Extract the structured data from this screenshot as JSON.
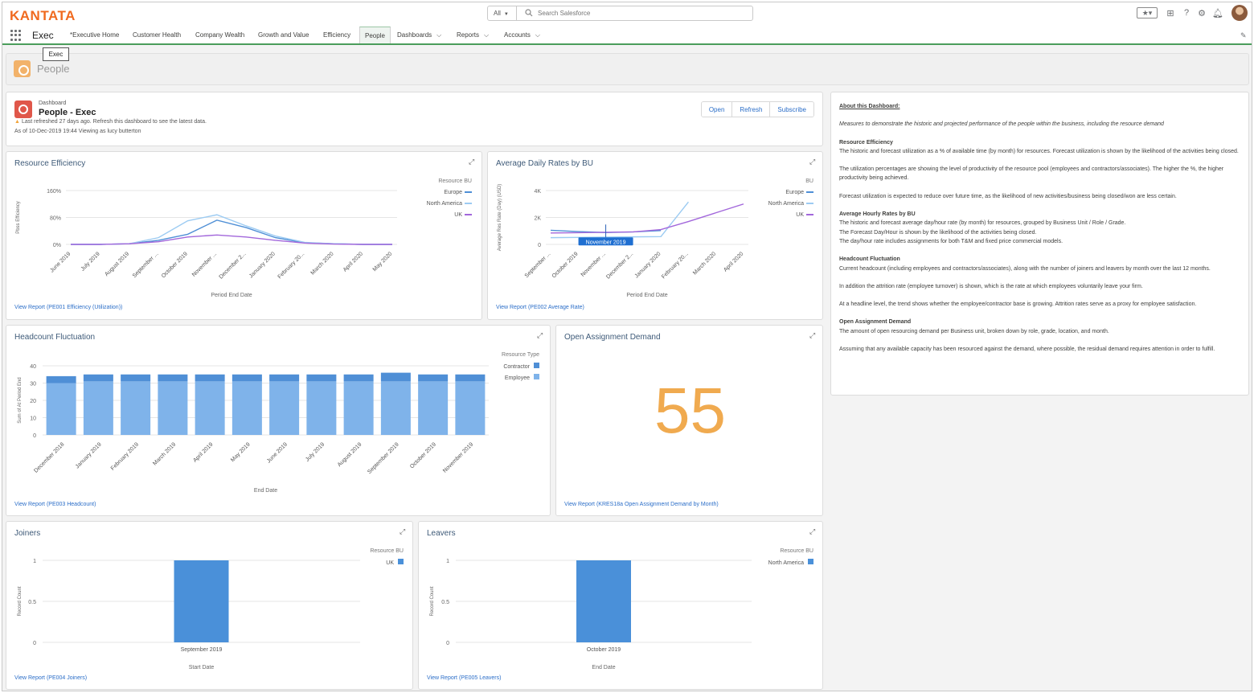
{
  "header": {
    "logo": "KANTATA",
    "search_scope": "All",
    "search_placeholder": "Search Salesforce"
  },
  "nav": {
    "app_name": "Exec",
    "items": [
      {
        "label": "*Executive Home"
      },
      {
        "label": "Customer Health"
      },
      {
        "label": "Company Wealth"
      },
      {
        "label": "Growth and Value"
      },
      {
        "label": "Efficiency"
      },
      {
        "label": "People"
      },
      {
        "label": "Dashboards"
      },
      {
        "label": "Reports"
      },
      {
        "label": "Accounts"
      }
    ],
    "tooltip": "Exec"
  },
  "page": {
    "title": "People"
  },
  "dashboard": {
    "eyebrow": "Dashboard",
    "title": "People - Exec",
    "warning": "Last refreshed 27 days ago. Refresh this dashboard to see the latest data.",
    "as_of": "As of 10-Dec-2019 19:44 Viewing as lucy butterton",
    "buttons": {
      "open": "Open",
      "refresh": "Refresh",
      "subscribe": "Subscribe"
    }
  },
  "cards": {
    "efficiency": {
      "title": "Resource Efficiency",
      "link": "View Report (PE001 Efficiency (Utilization))"
    },
    "rates": {
      "title": "Average Daily Rates by BU",
      "link": "View Report (PE002 Average Rate)"
    },
    "headcount": {
      "title": "Headcount Fluctuation",
      "link": "View Report (PE003 Headcount)"
    },
    "demand": {
      "title": "Open Assignment Demand",
      "value": "55",
      "link": "View Report (KRES18a Open Assignment Demand by Month)"
    },
    "joiners": {
      "title": "Joiners",
      "link": "View Report (PE004 Joiners)"
    },
    "leavers": {
      "title": "Leavers",
      "link": "View Report (PE005 Leavers)"
    }
  },
  "about": {
    "heading": "About this Dashboard:",
    "intro": "Measures to demonstrate the historic and projected performance of the people within the business, including the resource demand",
    "s1_h": "Resource Efficiency",
    "s1_p1": "The historic and forecast utilization as a % of available time (by month) for resources. Forecast utilization is shown by the likelihood of the activities being closed.",
    "s1_p2": "The utilization percentages are showing the level of productivity of the resource pool (employees and contractors/associates). The higher the %, the higher productivity being achieved.",
    "s1_p3": "Forecast utilization is expected to reduce over future time, as the likelihood of new activities/business being closed/won are less certain.",
    "s2_h": "Average Hourly Rates by BU",
    "s2_l1": "The historic and forecast average day/hour rate (by month) for resources, grouped by Business Unit / Role / Grade.",
    "s2_l2": "The Forecast Day/Hour is shown by the likelihood of the activities being closed.",
    "s2_l3": "The day/hour rate includes assignments for both T&M and fixed price commercial models.",
    "s3_h": "Headcount Fluctuation",
    "s3_p1": "Current headcount (including employees and contractors/associates), along with the number of joiners and leavers by month over the last 12 months.",
    "s3_p2": "In addition the attrition rate (employee turnover) is shown, which is the rate at which employees voluntarily leave your firm.",
    "s3_p3": "At a headline level, the trend shows whether the employee/contractor base is growing. Attrition rates serve as a proxy for employee satisfaction.",
    "s4_h": "Open Assignment Demand",
    "s4_p1": "The amount of open resourcing demand per Business unit, broken down by role, grade, location, and month.",
    "s4_p2": "Assuming that any available capacity has been resourced against the demand, where possible, the residual demand requires attention in order to fulfill."
  },
  "chart_data": [
    {
      "id": "efficiency",
      "type": "line",
      "ylabel": "Pbss Efficiency",
      "xlabel": "Period End Date",
      "legend_title": "Resource BU",
      "yticks": [
        "160%",
        "80%",
        "0%"
      ],
      "ylim": [
        0,
        160
      ],
      "categories": [
        "June 2019",
        "July 2019",
        "August 2019",
        "September ...",
        "October 2019",
        "November ...",
        "December 2...",
        "January 2020",
        "February 20...",
        "March 2020",
        "April 2020",
        "May 2020"
      ],
      "series": [
        {
          "name": "Europe",
          "color": "#4f8fd6",
          "values": [
            0,
            0,
            2,
            12,
            30,
            72,
            50,
            20,
            5,
            2,
            0,
            0
          ]
        },
        {
          "name": "North America",
          "color": "#9ccbf2",
          "values": [
            0,
            0,
            2,
            20,
            70,
            88,
            55,
            25,
            6,
            2,
            0,
            0
          ]
        },
        {
          "name": "UK",
          "color": "#a267db",
          "values": [
            0,
            0,
            2,
            8,
            22,
            28,
            22,
            12,
            4,
            1,
            0,
            0
          ]
        }
      ]
    },
    {
      "id": "rates",
      "type": "line",
      "ylabel": "Average Res Rate (Day) (USD)",
      "xlabel": "Period End Date",
      "legend_title": "BU",
      "yticks": [
        "4K",
        "2K",
        "0"
      ],
      "ylim": [
        0,
        4000
      ],
      "tooltip": "November 2019",
      "categories": [
        "September ...",
        "October 2019",
        "November ...",
        "December 2...",
        "January 2020",
        "February 20...",
        "March 2020",
        "April 2020"
      ],
      "series": [
        {
          "name": "Europe",
          "color": "#4f8fd6",
          "values": [
            1050,
            950,
            880,
            930,
            1030,
            null,
            null,
            null
          ]
        },
        {
          "name": "North America",
          "color": "#9ccbf2",
          "values": [
            500,
            520,
            540,
            560,
            580,
            3150,
            null,
            null
          ]
        },
        {
          "name": "UK",
          "color": "#a267db",
          "values": [
            850,
            870,
            900,
            930,
            1100,
            1700,
            2350,
            3000
          ]
        }
      ]
    },
    {
      "id": "headcount",
      "type": "bar",
      "stacked": true,
      "ylabel": "Sum of At Period End",
      "xlabel": "End Date",
      "legend_title": "Resource Type",
      "ylim": [
        0,
        40
      ],
      "yticks": [
        40,
        30,
        20,
        10,
        0
      ],
      "categories": [
        "December 2018",
        "January 2019",
        "February 2019",
        "March 2019",
        "April 2019",
        "May 2019",
        "June 2019",
        "July 2019",
        "August 2019",
        "September 2019",
        "October 2019",
        "November 2019"
      ],
      "series": [
        {
          "name": "Employee",
          "color": "#7fb3ea",
          "values": [
            30,
            31,
            31,
            31,
            31,
            31,
            31,
            31,
            31,
            31,
            31,
            31
          ]
        },
        {
          "name": "Contractor",
          "color": "#4f8fd6",
          "values": [
            4,
            4,
            4,
            4,
            4,
            4,
            4,
            4,
            4,
            5,
            4,
            4
          ]
        }
      ]
    },
    {
      "id": "joiners",
      "type": "bar",
      "ylabel": "Record Count",
      "xlabel": "Start Date",
      "legend_title": "Resource BU",
      "ylim": [
        0,
        1
      ],
      "yticks": [
        "1",
        "0.5",
        "0"
      ],
      "categories": [
        "September 2019"
      ],
      "series": [
        {
          "name": "UK",
          "color": "#4a90d9",
          "values": [
            1
          ]
        }
      ]
    },
    {
      "id": "leavers",
      "type": "bar",
      "ylabel": "Record Count",
      "xlabel": "End Date",
      "legend_title": "Resource BU",
      "ylim": [
        0,
        1
      ],
      "yticks": [
        "1",
        "0.5",
        "0"
      ],
      "categories": [
        "October 2019"
      ],
      "series": [
        {
          "name": "North America",
          "color": "#4a90d9",
          "values": [
            1
          ]
        }
      ]
    }
  ]
}
